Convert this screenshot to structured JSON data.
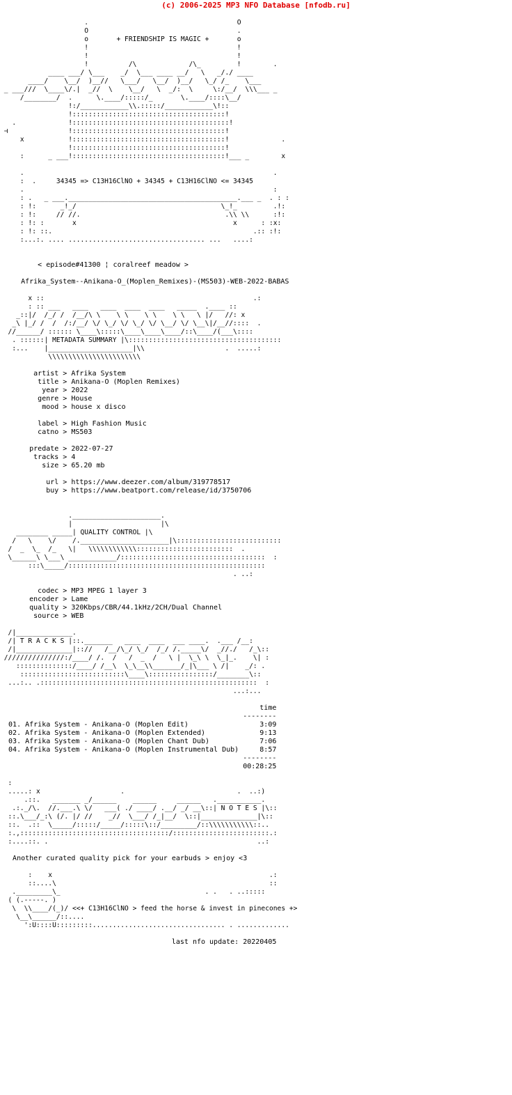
{
  "page": {
    "type": "nfo-release-file",
    "background_color": "#ffffff",
    "text_color": "#000000",
    "accent_color": "#e00000"
  },
  "topbar": {
    "text": "(c) 2006-2025 MP3 NFO Database [nfodb.ru]",
    "color": "#e00000"
  },
  "header": {
    "tagline": "+ FRIENDSHIP IS MAGIC +",
    "formula": "34345 => C13H16ClNO + 34345 + C13H16ClNO <= 34345",
    "episode": "< episode#41300 ¦ coralreef meadow >",
    "release_name": "Afrika_System--Anikana-O_(Moplen_Remixes)-(MS503)-WEB-2022-BABAS"
  },
  "banners": {
    "metadata": "METADATA SUMMARY",
    "quality": "QUALITY CONTROL",
    "tracks": "T R A C K S",
    "notes": "N O T E S"
  },
  "metadata": {
    "groups": [
      [
        {
          "key": "artist",
          "sep": ">",
          "value": "Afrika System"
        },
        {
          "key": "title",
          "sep": ">",
          "value": "Anikana-O (Moplen Remixes)"
        },
        {
          "key": "year",
          "sep": ">",
          "value": "2022"
        },
        {
          "key": "genre",
          "sep": ">",
          "value": "House"
        },
        {
          "key": "mood",
          "sep": ">",
          "value": "house x disco"
        }
      ],
      [
        {
          "key": "label",
          "sep": ">",
          "value": "High Fashion Music"
        },
        {
          "key": "catno",
          "sep": ">",
          "value": "MS503"
        }
      ],
      [
        {
          "key": "predate",
          "sep": ">",
          "value": "2022-07-27"
        },
        {
          "key": "tracks",
          "sep": ">",
          "value": "4"
        },
        {
          "key": "size",
          "sep": ">",
          "value": "65.20 mb"
        }
      ],
      [
        {
          "key": "url",
          "sep": ">",
          "value": "https://www.deezer.com/album/319778517"
        },
        {
          "key": "buy",
          "sep": ">",
          "value": "https://www.beatport.com/release/id/3750706"
        }
      ]
    ]
  },
  "quality": {
    "fields": [
      {
        "key": "codec",
        "sep": ">",
        "value": "MP3 MPEG 1 layer 3"
      },
      {
        "key": "encoder",
        "sep": ">",
        "value": "Lame"
      },
      {
        "key": "quality",
        "sep": ">",
        "value": "320Kbps/CBR/44.1kHz/2CH/Dual Channel"
      },
      {
        "key": "source",
        "sep": ">",
        "value": "WEB"
      }
    ]
  },
  "tracklist": {
    "time_header": "time",
    "rule": "--------",
    "total": "00:28:25",
    "items": [
      {
        "num": "01.",
        "title": "Afrika System - Anikana-O (Moplen Edit)",
        "time": "3:09"
      },
      {
        "num": "02.",
        "title": "Afrika System - Anikana-O (Moplen Extended)",
        "time": "9:13"
      },
      {
        "num": "03.",
        "title": "Afrika System - Anikana-O (Moplen Chant Dub)",
        "time": "7:06"
      },
      {
        "num": "04.",
        "title": "Afrika System - Anikana-O (Moplen Instrumental Dub)",
        "time": "8:57"
      }
    ]
  },
  "notes": {
    "text": "Another curated quality pick for your earbuds > enjoy <3"
  },
  "footer": {
    "slogan": "<<+ C13H16ClNO > feed the horse & invest in pinecones +>",
    "last_update": "last nfo update: 20220405"
  },
  "ascii": {
    "header_art": [
      "                     .                                     O                ",
      "                     O                                     .                ",
      "                     o       + FRIENDSHIP IS MAGIC +       o                ",
      "                     !                                     !                ",
      "                     !                 .                   !      .         ",
      "                     !        /\\       !     /\\-       _!_/           ",
      "        _ __ /_!_)__/   \\__ _/  )__/  \\ ./ _/ ___      _",
      " _ _ ///  \\____\\/.| _// \\__ \\ /_.| _//  \\ \\!_/ _/ ____\\///  __ _",
      "      /________/ .   \\.____/:/    /_  \\____/      _/",
      "             !:/__________\\\\.:::::/__________\\!::            ",
      "             !::::::::::::::::::::::::::::::::::::!            ",
      "   .         !::::::::::::::::::::::::::::::::::::!            ",
      " ⊣           !::::::::::::::::::::::::::::::::::::!            ",
      "    x         !::::::::::::::::::::::::::::::::::::!       .   ",
      "             !::::::::::::::::::::::::::::::::::::!            ",
      "    :     _ __!::::::::::::::::::::::::::::::::::::!__ _      x",
      "                                                                ",
      "    .                                                      .    ",
      "    : .      34345 => C13H16ClNO + 34345 + C13H16ClNO <= 34345  ",
      "    .                                                      :    ",
      "    : .   _ __.____________________________________.__ _   . : :",
      "    :  !.    _!_/                                  \\_!_      .!:",
      "    : !:    _/_/.                                    .\\_\\      :!:",
      "    : !:  // //.                                      .\\\\ \\\\   :!:",
      "    : !: :   x                                          x   : :x:",
      "    : !: ::.                                              .:: :!:",
      "    :...:. .... ............................... ...  ....:"
    ]
  }
}
